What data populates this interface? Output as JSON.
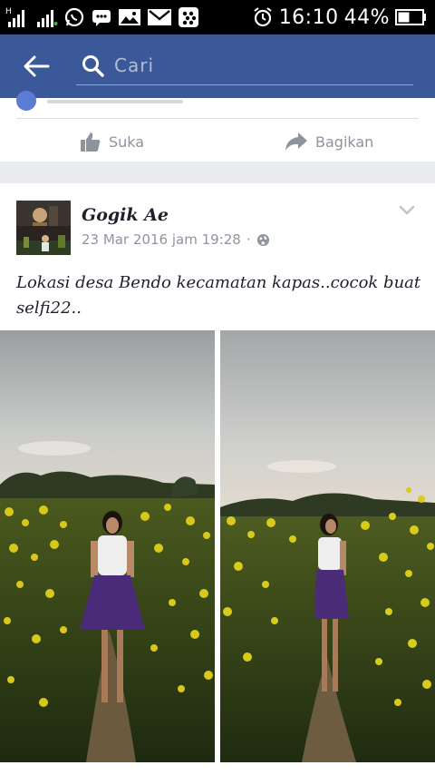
{
  "status_bar": {
    "clock": "16:10",
    "battery": "44%",
    "icons": [
      "hplus-signal-icon",
      "signal-icon",
      "whatsapp-icon",
      "bbm-chat-icon",
      "gallery-icon",
      "gmail-icon",
      "blackberry-messenger-icon",
      "alarm-icon",
      "battery-icon"
    ]
  },
  "header": {
    "back_icon": "arrow-left-icon",
    "search_placeholder": "Cari",
    "search_icon": "search-icon",
    "bar_color": "#3b5998"
  },
  "previous_post": {
    "like_label": "Suka",
    "share_label": "Bagikan"
  },
  "post": {
    "author": "Gogik Ae",
    "timestamp": "23 Mar 2016 jam 19:28",
    "separator": "·",
    "privacy_icon": "globe-icon",
    "menu_icon": "chevron-down-icon",
    "text": "Lokasi desa Bendo kecamatan kapas..cocok buat selfi22..",
    "photos": [
      "girl-in-yellow-flower-field-front",
      "girl-in-yellow-flower-field-side"
    ]
  }
}
